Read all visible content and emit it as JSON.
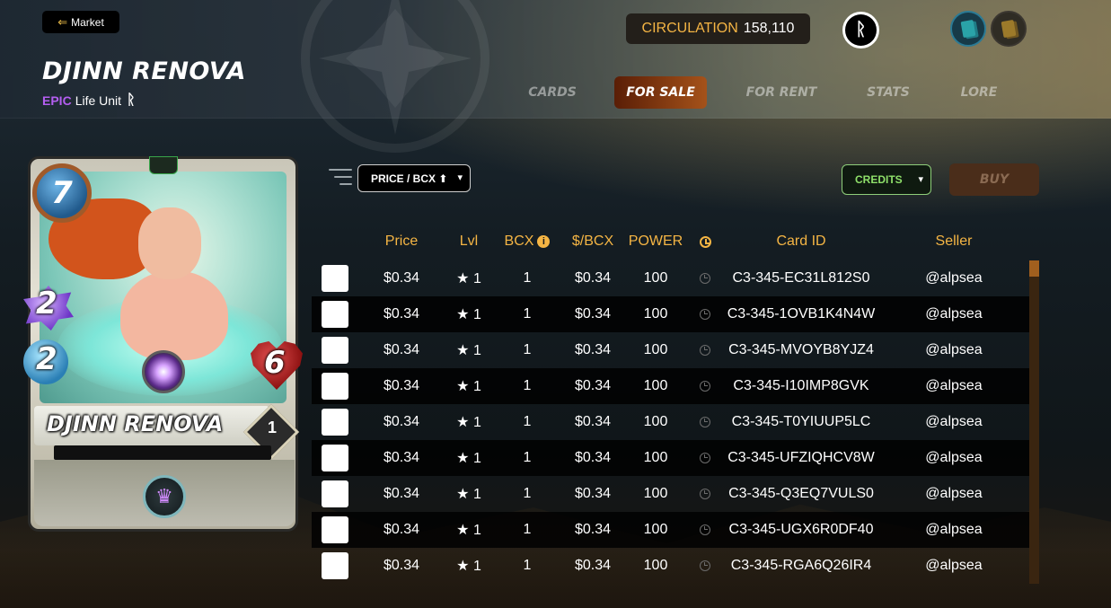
{
  "header": {
    "back_label": "Market",
    "card_name": "DJINN RENOVA",
    "rarity": "EPIC",
    "card_type": "Life Unit",
    "circulation_label": "CIRCULATION",
    "circulation_value": "158,110",
    "tabs": [
      {
        "label": "CARDS",
        "active": false
      },
      {
        "label": "FOR SALE",
        "active": true
      },
      {
        "label": "FOR RENT",
        "active": false
      },
      {
        "label": "STATS",
        "active": false
      },
      {
        "label": "LORE",
        "active": false
      }
    ]
  },
  "card": {
    "name": "DJINN RENOVA",
    "mana": "7",
    "magic": "2",
    "speed": "2",
    "health": "6",
    "level": "1"
  },
  "controls": {
    "sort_value": "PRICE / BCX ⬆",
    "currency_value": "CREDITS",
    "buy_label": "BUY"
  },
  "table": {
    "columns": [
      "Price",
      "Lvl",
      "BCX",
      "$/BCX",
      "POWER",
      "Card ID",
      "Seller"
    ],
    "rows": [
      {
        "price": "$0.34",
        "lvl": "★ 1",
        "bcx": "1",
        "per_bcx": "$0.34",
        "power": "100",
        "card_id": "C3-345-EC31L812S0",
        "seller": "@alpsea"
      },
      {
        "price": "$0.34",
        "lvl": "★ 1",
        "bcx": "1",
        "per_bcx": "$0.34",
        "power": "100",
        "card_id": "C3-345-1OVB1K4N4W",
        "seller": "@alpsea"
      },
      {
        "price": "$0.34",
        "lvl": "★ 1",
        "bcx": "1",
        "per_bcx": "$0.34",
        "power": "100",
        "card_id": "C3-345-MVOYB8YJZ4",
        "seller": "@alpsea"
      },
      {
        "price": "$0.34",
        "lvl": "★ 1",
        "bcx": "1",
        "per_bcx": "$0.34",
        "power": "100",
        "card_id": "C3-345-I10IMP8GVK",
        "seller": "@alpsea"
      },
      {
        "price": "$0.34",
        "lvl": "★ 1",
        "bcx": "1",
        "per_bcx": "$0.34",
        "power": "100",
        "card_id": "C3-345-T0YIUUP5LC",
        "seller": "@alpsea"
      },
      {
        "price": "$0.34",
        "lvl": "★ 1",
        "bcx": "1",
        "per_bcx": "$0.34",
        "power": "100",
        "card_id": "C3-345-UFZIQHCV8W",
        "seller": "@alpsea"
      },
      {
        "price": "$0.34",
        "lvl": "★ 1",
        "bcx": "1",
        "per_bcx": "$0.34",
        "power": "100",
        "card_id": "C3-345-Q3EQ7VULS0",
        "seller": "@alpsea"
      },
      {
        "price": "$0.34",
        "lvl": "★ 1",
        "bcx": "1",
        "per_bcx": "$0.34",
        "power": "100",
        "card_id": "C3-345-UGX6R0DF40",
        "seller": "@alpsea"
      },
      {
        "price": "$0.34",
        "lvl": "★ 1",
        "bcx": "1",
        "per_bcx": "$0.34",
        "power": "100",
        "card_id": "C3-345-RGA6Q26IR4",
        "seller": "@alpsea"
      }
    ]
  },
  "colors": {
    "accent_gold": "#f5b544",
    "rarity_epic": "#b45ef0",
    "credits_green": "#8fe06a",
    "active_tab": "#a5521a"
  },
  "icons": [
    "back-arrow-icon",
    "edition-icon",
    "logo-icon",
    "deck-blue-icon",
    "deck-gold-icon",
    "filter-icon",
    "info-icon",
    "clock-icon",
    "chevron-down-icon"
  ]
}
